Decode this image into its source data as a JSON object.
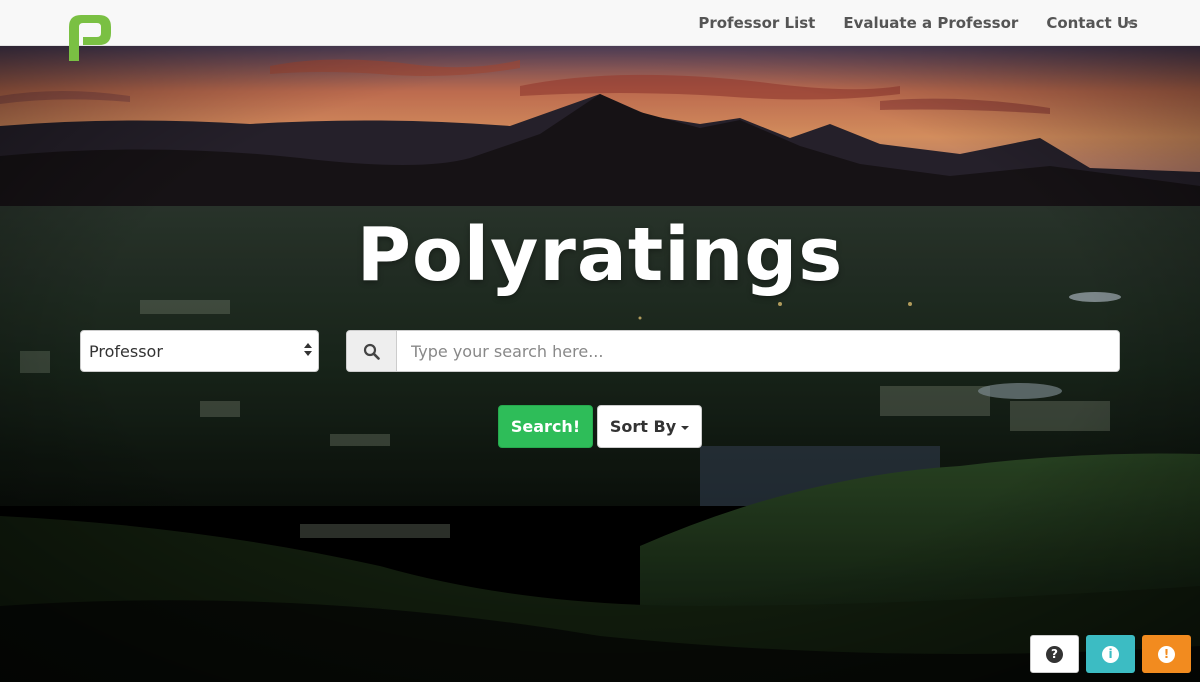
{
  "brand": {
    "logo_icon": "polyratings-p-logo-icon",
    "color": "#7ac043"
  },
  "nav": {
    "items": [
      {
        "label": "Professor List"
      },
      {
        "label": "Evaluate a Professor"
      },
      {
        "label": "Contact Us"
      }
    ],
    "dropdown_icon": "caret-down-icon"
  },
  "hero": {
    "title": "Polyratings"
  },
  "search": {
    "type_select": {
      "selected": "Professor"
    },
    "input": {
      "placeholder": "Type your search here...",
      "value": ""
    },
    "search_icon": "search-icon",
    "submit_label": "Search!",
    "sort_label": "Sort By",
    "submit_color": "#2ebd59"
  },
  "corner_buttons": [
    {
      "icon": "question-circle-icon",
      "glyph": "?",
      "color": "#ffffff"
    },
    {
      "icon": "info-circle-icon",
      "glyph": "i",
      "color": "#3cbcc3"
    },
    {
      "icon": "exclamation-circle-icon",
      "glyph": "!",
      "color": "#f28b1f"
    }
  ]
}
